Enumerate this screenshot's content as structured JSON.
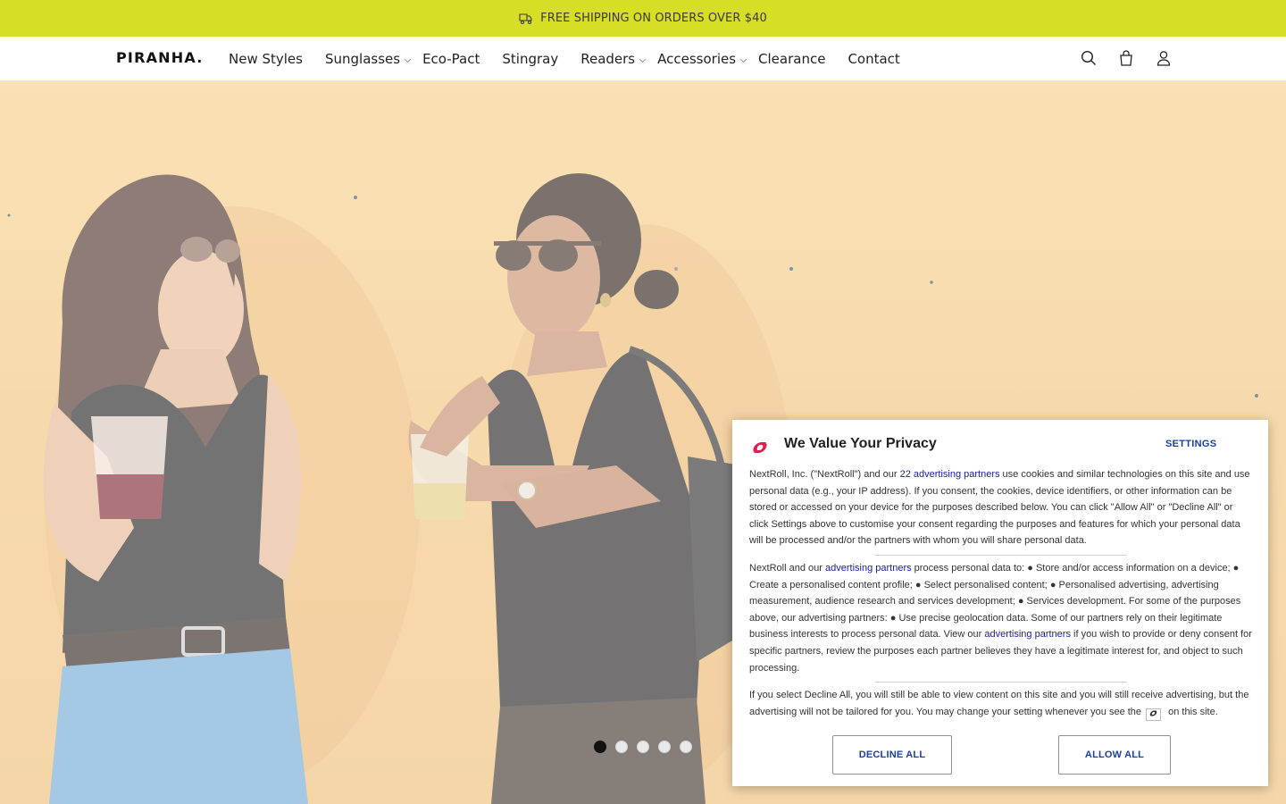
{
  "announcement": {
    "icon": "delivery-truck-icon",
    "text": "FREE SHIPPING ON ORDERS OVER $40"
  },
  "header": {
    "logo": "PIRANHA.",
    "nav": [
      {
        "label": "New Styles",
        "has_dropdown": false
      },
      {
        "label": "Sunglasses",
        "has_dropdown": true
      },
      {
        "label": "Eco-Pact",
        "has_dropdown": false
      },
      {
        "label": "Stingray",
        "has_dropdown": false
      },
      {
        "label": "Readers",
        "has_dropdown": true
      },
      {
        "label": "Accessories",
        "has_dropdown": true
      },
      {
        "label": "Clearance",
        "has_dropdown": false
      },
      {
        "label": "Contact",
        "has_dropdown": false
      }
    ],
    "icons": [
      "search-icon",
      "cart-icon",
      "account-icon"
    ]
  },
  "hero": {
    "slides_total": 5,
    "active_slide": 1
  },
  "privacy": {
    "title": "We Value Your Privacy",
    "settings_label": "SETTINGS",
    "p1": {
      "before": "NextRoll, Inc. (\"NextRoll\") and our ",
      "link": "22 advertising partners",
      "after": " use cookies and similar technologies on this site and use personal data (e.g., your IP address). If you consent, the cookies, device identifiers, or other information can be stored or accessed on your device for the purposes described below. You can click \"Allow All\" or \"Decline All\" or click Settings above to customise your consent regarding the purposes and features for which your personal data will be processed and/or the partners with whom you will share personal data."
    },
    "p2": {
      "before": "NextRoll and our ",
      "link1": "advertising partners",
      "middle": " process personal data to: ● Store and/or access information on a device; ● Create a personalised content profile; ● Select personalised content; ● Personalised advertising, advertising measurement, audience research and services development; ● Services development. For some of the purposes above, our advertising partners: ● Use precise geolocation data. Some of our partners rely on their legitimate business interests to process personal data. View our ",
      "link2": "advertising partners",
      "after": " if you wish to provide or deny consent for specific partners, review the purposes each partner believes they have a legitimate interest for, and object to such processing."
    },
    "p3": {
      "before": "If you select Decline All, you will still be able to view content on this site and you will still receive advertising, but the advertising will not be tailored for you. You may change your setting whenever you see the",
      "after": "on this site."
    },
    "decline_label": "DECLINE ALL",
    "allow_label": "ALLOW ALL",
    "brand_color": "#e31b4f",
    "link_color": "#1a1aad"
  }
}
